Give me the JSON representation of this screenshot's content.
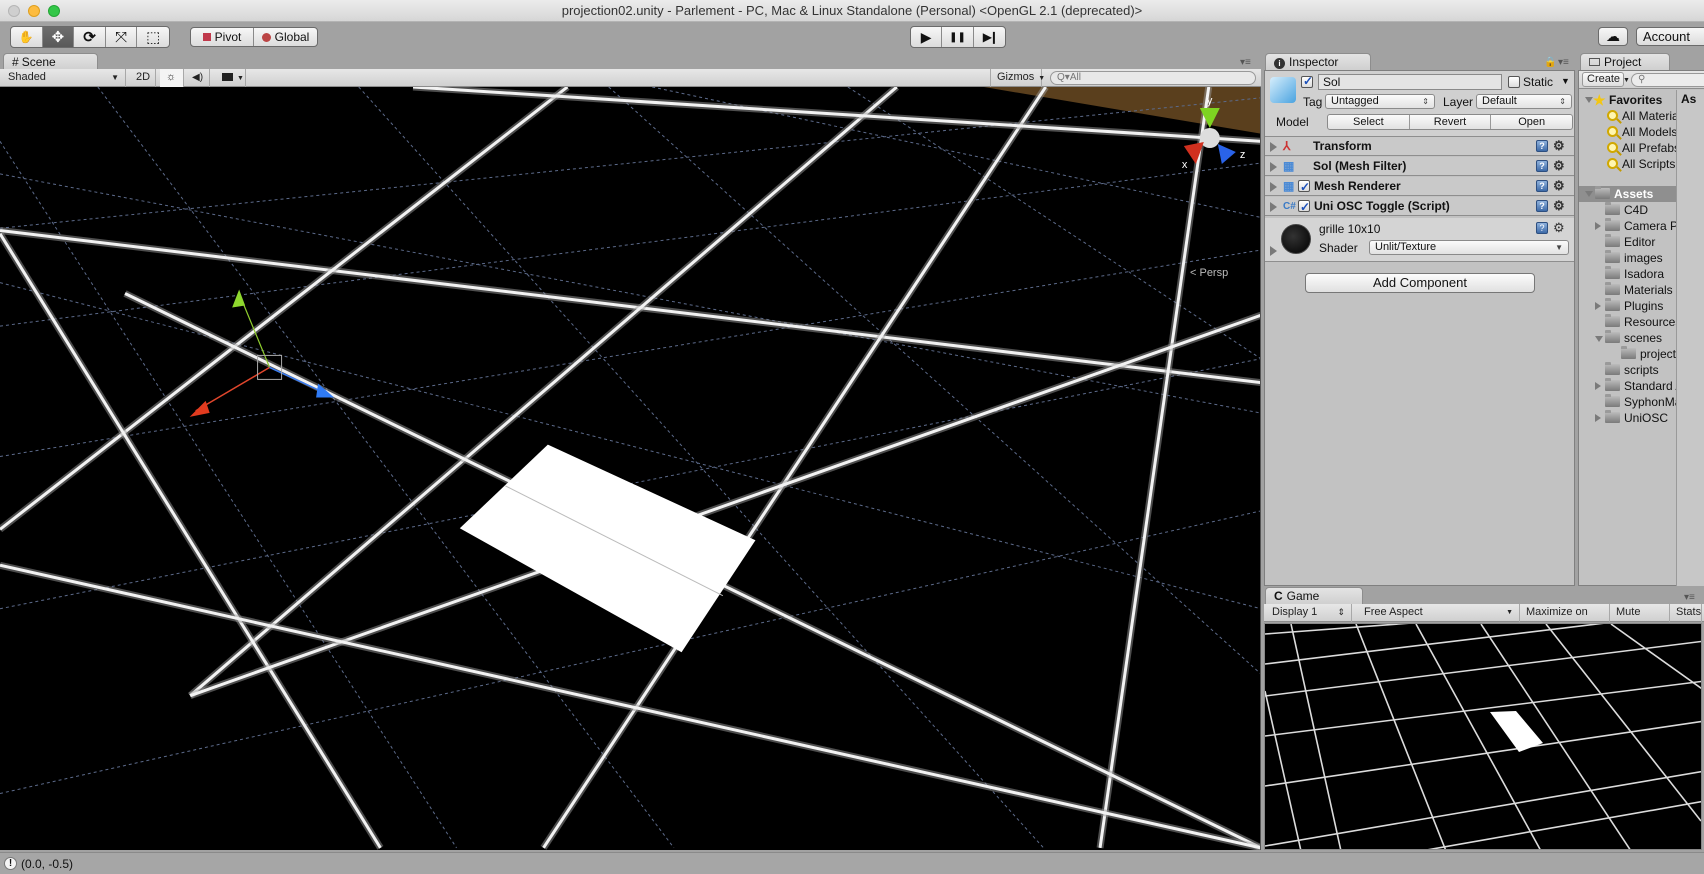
{
  "window": {
    "title": "projection02.unity - Parlement - PC, Mac & Linux Standalone (Personal) <OpenGL 2.1 (deprecated)>",
    "controls": [
      "close",
      "minimize",
      "zoom"
    ]
  },
  "toolbar": {
    "tools": [
      {
        "name": "hand-tool",
        "icon": "hand-icon",
        "glyph": "✋",
        "active": false
      },
      {
        "name": "move-tool",
        "icon": "move-icon",
        "glyph": "✥",
        "active": true
      },
      {
        "name": "rotate-tool",
        "icon": "rotate-icon",
        "glyph": "⟳",
        "active": false
      },
      {
        "name": "scale-tool",
        "icon": "scale-icon",
        "glyph": "⤧",
        "active": false
      },
      {
        "name": "rect-tool",
        "icon": "rect-icon",
        "glyph": "⬚",
        "active": false
      }
    ],
    "pivot_label": "Pivot",
    "global_label": "Global",
    "play_glyph": "▶",
    "pause_glyph": "❚❚",
    "step_glyph": "▶❙",
    "cloud_glyph": "☁",
    "account_label": "Account"
  },
  "scene": {
    "tab_label": "Scene",
    "tab_icon": "#",
    "shading_mode": "Shaded",
    "mode_2d_label": "2D",
    "lighting_glyph": "☼",
    "audio_glyph": "🔈",
    "effects_glyph": "▣",
    "gizmos_label": "Gizmos",
    "search_placeholder": "All",
    "persp_label": "< Persp",
    "axis_labels": {
      "x": "x",
      "y": "y",
      "z": "z"
    },
    "sky_color": "#5a3f1d",
    "ground_color": "#000000"
  },
  "inspector": {
    "tab_label": "Inspector",
    "object_name": "Sol",
    "active": true,
    "static_label": "Static",
    "static_checked": false,
    "tag_label": "Tag",
    "tag_value": "Untagged",
    "layer_label": "Layer",
    "layer_value": "Default",
    "model_label": "Model",
    "model_buttons": [
      "Select",
      "Revert",
      "Open"
    ],
    "components": [
      {
        "name": "Transform",
        "icon": "transform-icon",
        "has_checkbox": false
      },
      {
        "name": "Sol (Mesh Filter)",
        "icon": "mesh-filter-icon",
        "has_checkbox": false
      },
      {
        "name": "Mesh Renderer",
        "icon": "mesh-renderer-icon",
        "has_checkbox": true,
        "checked": true
      },
      {
        "name": "Uni OSC Toggle (Script)",
        "icon": "script-icon",
        "has_checkbox": true,
        "checked": true
      }
    ],
    "material": {
      "name": "grille 10x10",
      "shader_label": "Shader",
      "shader_value": "Unlit/Texture"
    },
    "add_component_label": "Add Component"
  },
  "project": {
    "tab_label": "Project",
    "create_label": "Create",
    "search_placeholder": "",
    "right_header": "As",
    "favorites_label": "Favorites",
    "favorites": [
      "All Materials",
      "All Models",
      "All Prefabs",
      "All Scripts"
    ],
    "assets_label": "Assets",
    "assets": [
      {
        "name": "C4D",
        "expandable": false,
        "expanded": false,
        "depth": 1
      },
      {
        "name": "Camera Pers",
        "expandable": true,
        "expanded": false,
        "depth": 1
      },
      {
        "name": "Editor",
        "expandable": false,
        "expanded": false,
        "depth": 1
      },
      {
        "name": "images",
        "expandable": false,
        "expanded": false,
        "depth": 1
      },
      {
        "name": "Isadora",
        "expandable": false,
        "expanded": false,
        "depth": 1
      },
      {
        "name": "Materials",
        "expandable": false,
        "expanded": false,
        "depth": 1
      },
      {
        "name": "Plugins",
        "expandable": true,
        "expanded": false,
        "depth": 1
      },
      {
        "name": "Resources",
        "expandable": false,
        "expanded": false,
        "depth": 1
      },
      {
        "name": "scenes",
        "expandable": true,
        "expanded": true,
        "depth": 1
      },
      {
        "name": "projectio",
        "expandable": false,
        "expanded": false,
        "depth": 2
      },
      {
        "name": "scripts",
        "expandable": false,
        "expanded": false,
        "depth": 1
      },
      {
        "name": "Standard As",
        "expandable": true,
        "expanded": false,
        "depth": 1
      },
      {
        "name": "SyphonMate",
        "expandable": false,
        "expanded": false,
        "depth": 1
      },
      {
        "name": "UniOSC",
        "expandable": true,
        "expanded": false,
        "depth": 1
      }
    ]
  },
  "game": {
    "tab_label": "Game",
    "display_value": "Display 1",
    "aspect_value": "Free Aspect",
    "maximize_label": "Maximize on Play",
    "mute_label": "Mute audio",
    "stats_label": "Stats"
  },
  "status": {
    "message": "(0.0, -0.5)",
    "icon": "warning-icon"
  }
}
